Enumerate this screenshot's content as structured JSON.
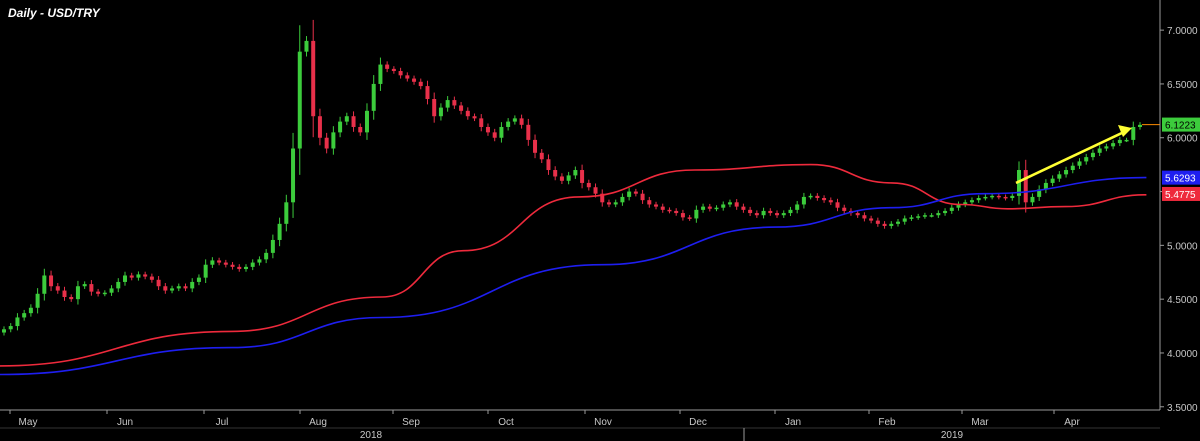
{
  "chart_data": {
    "type": "candlestick",
    "title": "Daily - USD/TRY",
    "ylim": [
      3.47,
      7.28
    ],
    "y_ticks": [
      "7.0000",
      "6.5000",
      "6.0000",
      "5.5000",
      "5.0000",
      "4.5000",
      "4.0000",
      "3.5000"
    ],
    "y_tick_values": [
      7.0,
      6.5,
      6.0,
      5.5,
      5.0,
      4.5,
      4.0,
      3.5
    ],
    "x_month_labels": [
      "May",
      "Jun",
      "Jul",
      "Aug",
      "Sep",
      "Oct",
      "Nov",
      "Dec",
      "Jan",
      "Feb",
      "Mar",
      "Apr"
    ],
    "x_year_labels": [
      "2018",
      "2019"
    ],
    "colors": {
      "background": "#000000",
      "up": "#3ccc3c",
      "down": "#e8304a",
      "ma_fast": "#1e1ef0",
      "ma_slow": "#ee2a3c",
      "arrow": "#ffff33",
      "axis": "#9a9a9a",
      "price_line": "#ff8c00"
    },
    "price_tags": [
      {
        "label": "6.1223",
        "value": 6.1223,
        "color": "#3ccc3c"
      },
      {
        "label": "5.6293",
        "value": 5.6293,
        "color": "#1e1ef0"
      },
      {
        "label": "5.4775",
        "value": 5.4775,
        "color": "#ee2a3c"
      }
    ],
    "series_close": [
      4.22,
      4.25,
      4.33,
      4.37,
      4.42,
      4.55,
      4.72,
      4.62,
      4.58,
      4.52,
      4.5,
      4.62,
      4.64,
      4.57,
      4.55,
      4.56,
      4.6,
      4.66,
      4.72,
      4.7,
      4.73,
      4.71,
      4.68,
      4.62,
      4.58,
      4.6,
      4.62,
      4.6,
      4.66,
      4.7,
      4.82,
      4.86,
      4.84,
      4.82,
      4.8,
      4.78,
      4.8,
      4.84,
      4.87,
      4.93,
      5.05,
      5.2,
      5.4,
      5.9,
      6.8,
      6.9,
      6.2,
      6.0,
      5.9,
      6.05,
      6.15,
      6.2,
      6.1,
      6.05,
      6.25,
      6.5,
      6.68,
      6.64,
      6.62,
      6.58,
      6.55,
      6.52,
      6.48,
      6.36,
      6.2,
      6.28,
      6.35,
      6.3,
      6.25,
      6.2,
      6.18,
      6.1,
      6.05,
      6.0,
      6.1,
      6.15,
      6.18,
      6.12,
      5.98,
      5.86,
      5.8,
      5.7,
      5.64,
      5.6,
      5.65,
      5.7,
      5.58,
      5.54,
      5.48,
      5.4,
      5.38,
      5.4,
      5.45,
      5.5,
      5.48,
      5.42,
      5.38,
      5.36,
      5.33,
      5.32,
      5.3,
      5.26,
      5.25,
      5.33,
      5.36,
      5.34,
      5.35,
      5.38,
      5.4,
      5.36,
      5.33,
      5.3,
      5.28,
      5.32,
      5.3,
      5.28,
      5.3,
      5.33,
      5.38,
      5.45,
      5.46,
      5.44,
      5.42,
      5.4,
      5.35,
      5.32,
      5.3,
      5.28,
      5.25,
      5.23,
      5.2,
      5.18,
      5.2,
      5.22,
      5.25,
      5.26,
      5.27,
      5.28,
      5.28,
      5.3,
      5.32,
      5.35,
      5.38,
      5.4,
      5.42,
      5.44,
      5.45,
      5.46,
      5.45,
      5.44,
      5.46,
      5.7,
      5.4,
      5.45,
      5.52,
      5.58,
      5.62,
      5.66,
      5.7,
      5.74,
      5.78,
      5.82,
      5.86,
      5.9,
      5.92,
      5.95,
      5.98,
      5.98,
      6.1,
      6.12
    ],
    "ma_fast_points": [
      [
        0,
        3.8
      ],
      [
        0.2,
        4.05
      ],
      [
        0.33,
        4.33
      ],
      [
        0.52,
        4.82
      ],
      [
        0.67,
        5.17
      ],
      [
        0.77,
        5.35
      ],
      [
        0.85,
        5.48
      ],
      [
        0.99,
        5.63
      ]
    ],
    "ma_slow_points": [
      [
        0,
        3.88
      ],
      [
        0.2,
        4.2
      ],
      [
        0.33,
        4.52
      ],
      [
        0.4,
        4.95
      ],
      [
        0.5,
        5.45
      ],
      [
        0.6,
        5.7
      ],
      [
        0.7,
        5.75
      ],
      [
        0.77,
        5.58
      ],
      [
        0.83,
        5.38
      ],
      [
        0.87,
        5.34
      ],
      [
        0.92,
        5.36
      ],
      [
        0.99,
        5.47
      ]
    ]
  }
}
